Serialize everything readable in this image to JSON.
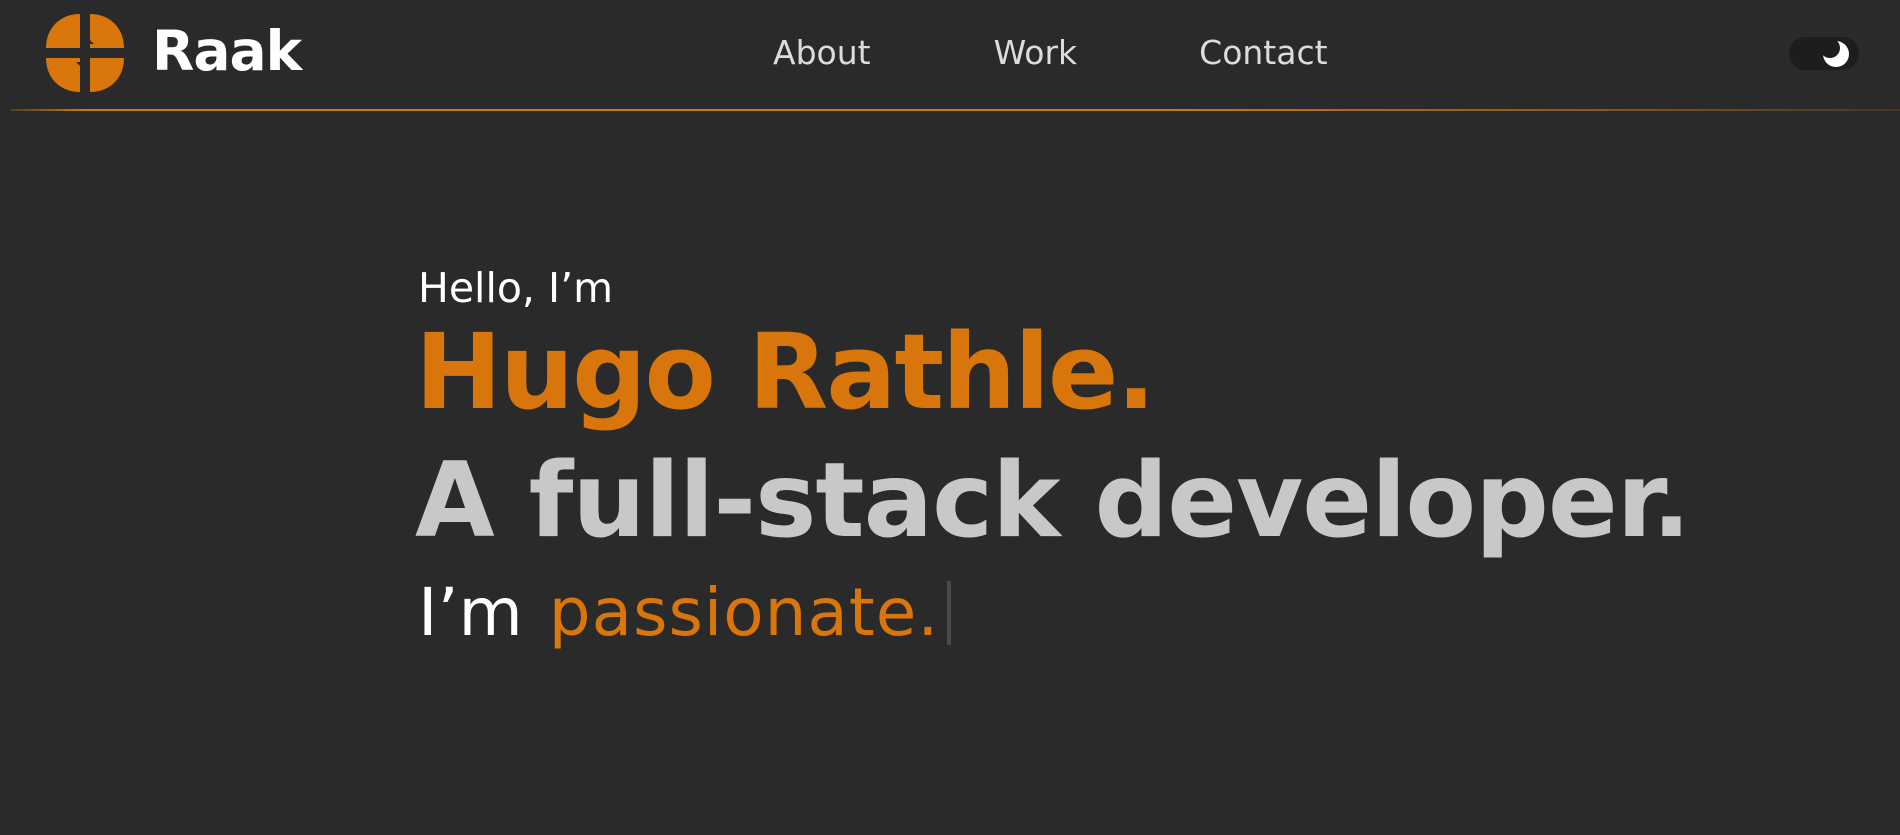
{
  "brand": {
    "name": "Raak",
    "color": "#d8760c"
  },
  "nav": {
    "links": [
      "About",
      "Work",
      "Contact"
    ]
  },
  "theme_toggle": {
    "icon": "moon-icon",
    "state": "dark"
  },
  "hero": {
    "greeting": "Hello, I’m",
    "name": "Hugo Rathle.",
    "role": "A full-stack developer.",
    "typing_prefix": "I’m",
    "typing_word": "passionate."
  },
  "colors": {
    "background": "#2a2a2a",
    "accent": "#d8760c",
    "nav_text": "#dcdcdc",
    "role_text": "#c8c8c8"
  }
}
